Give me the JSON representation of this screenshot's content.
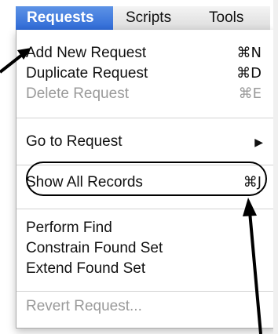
{
  "menubar": {
    "items": [
      {
        "label": "Requests",
        "active": true
      },
      {
        "label": "Scripts",
        "active": false
      },
      {
        "label": "Tools",
        "active": false
      }
    ]
  },
  "menu": {
    "groups": [
      [
        {
          "label": "Add New Request",
          "shortcut": "⌘N",
          "enabled": true
        },
        {
          "label": "Duplicate Request",
          "shortcut": "⌘D",
          "enabled": true
        },
        {
          "label": "Delete Request",
          "shortcut": "⌘E",
          "enabled": false
        }
      ],
      [
        {
          "label": "Go to Request",
          "submenu_icon": "triangle-right-icon",
          "enabled": true
        }
      ],
      [
        {
          "label": "Show All Records",
          "shortcut": "⌘J",
          "enabled": true,
          "circled": true
        }
      ],
      [
        {
          "label": "Perform Find",
          "enabled": true
        },
        {
          "label": "Constrain Found Set",
          "enabled": true
        },
        {
          "label": "Extend Found Set",
          "enabled": true
        }
      ],
      [
        {
          "label": "Revert Request...",
          "enabled": false
        }
      ]
    ]
  },
  "colors": {
    "accent": "#3a78e0",
    "disabled_text": "#9a9a9a",
    "annotation": "#000000"
  }
}
